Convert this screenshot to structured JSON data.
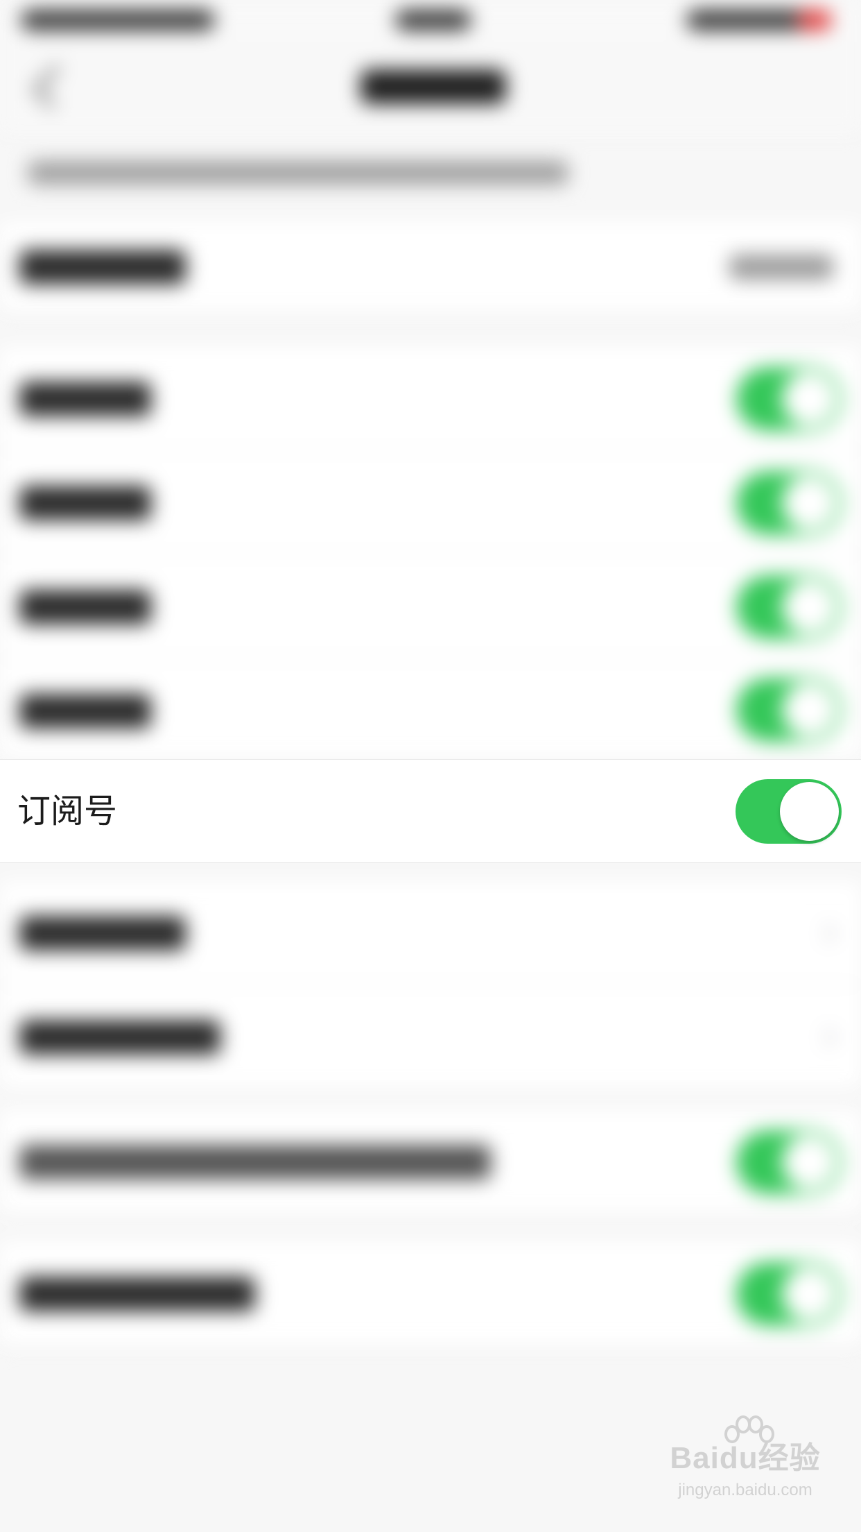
{
  "focused_row": {
    "label": "订阅号",
    "toggle_on": true
  },
  "colors": {
    "toggle_on": "#34c759",
    "background": "#f7f7f7",
    "row_background": "#ffffff",
    "label_text": "#1c1c1c"
  },
  "watermark": {
    "logo": "Baidu经验",
    "url": "jingyan.baidu.com"
  }
}
